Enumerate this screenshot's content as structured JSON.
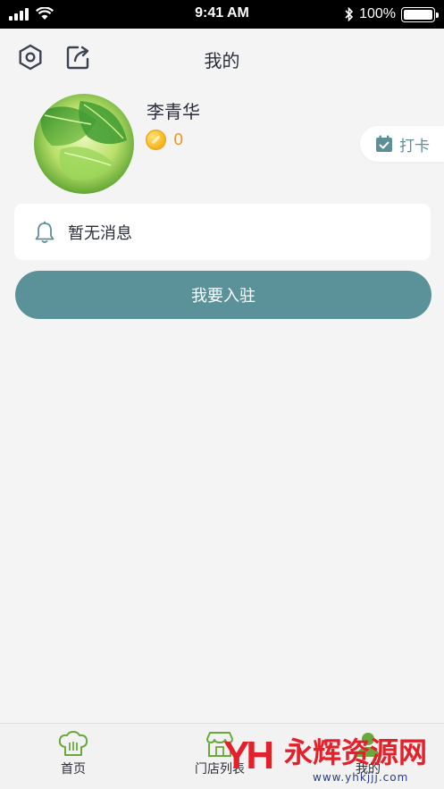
{
  "status_bar": {
    "time": "9:41 AM",
    "battery": "100%",
    "battery_level": 1.0,
    "icons": [
      "signal-icon",
      "wifi-icon",
      "bluetooth-icon",
      "battery-icon"
    ]
  },
  "navbar": {
    "title": "我的",
    "left_icons": [
      "settings-hexagon-icon",
      "share-icon"
    ]
  },
  "profile": {
    "name": "李青华",
    "coins": "0",
    "avatar_desc_icon": "avatar-green-leaf"
  },
  "checkin": {
    "label": "打卡",
    "icon": "calendar-check-icon"
  },
  "notice": {
    "text": "暂无消息",
    "icon": "bell-icon"
  },
  "join_button": {
    "label": "我要入驻"
  },
  "tabbar": {
    "items": [
      {
        "label": "首页",
        "icon": "chef-hat-icon"
      },
      {
        "label": "门店列表",
        "icon": "store-icon"
      },
      {
        "label": "我的",
        "icon": "profile-icon"
      }
    ]
  },
  "watermark": {
    "logo": "YH",
    "title": "永辉资源网",
    "url": "www.yhkjjj.com"
  },
  "colors": {
    "accent": "#5b9299",
    "coin": "#e59a2a",
    "watermark_red": "#e4202a",
    "background": "#f4f4f5"
  }
}
